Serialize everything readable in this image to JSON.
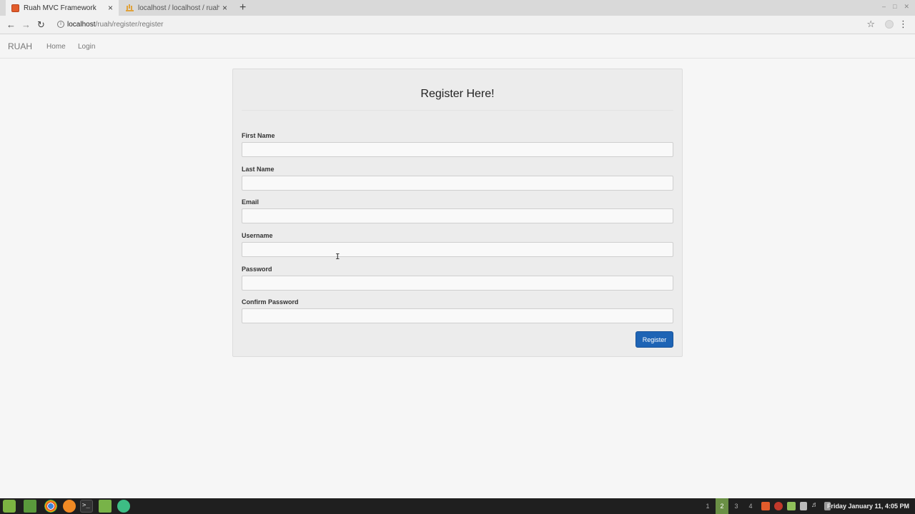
{
  "browser": {
    "tabs": [
      {
        "title": "Ruah MVC Framework",
        "active": true
      },
      {
        "title": "localhost / localhost / ruah / users | phpMyAdmin",
        "active": false
      }
    ],
    "new_tab": "+",
    "close_glyph": "×",
    "url_host": "localhost",
    "url_path": "/ruah/register/register"
  },
  "navbar": {
    "brand": "RUAH",
    "links": [
      "Home",
      "Login"
    ]
  },
  "form": {
    "title": "Register Here!",
    "fields": [
      {
        "label": "First Name",
        "value": ""
      },
      {
        "label": "Last Name",
        "value": ""
      },
      {
        "label": "Email",
        "value": ""
      },
      {
        "label": "Username",
        "value": ""
      },
      {
        "label": "Password",
        "value": ""
      },
      {
        "label": "Confirm Password",
        "value": ""
      }
    ],
    "submit_label": "Register",
    "accent_color": "#1e64b5"
  },
  "taskbar": {
    "workspaces": [
      "1",
      "2",
      "3",
      "4"
    ],
    "active_workspace": "2",
    "clock": "Friday January 11, 4:05 PM"
  }
}
